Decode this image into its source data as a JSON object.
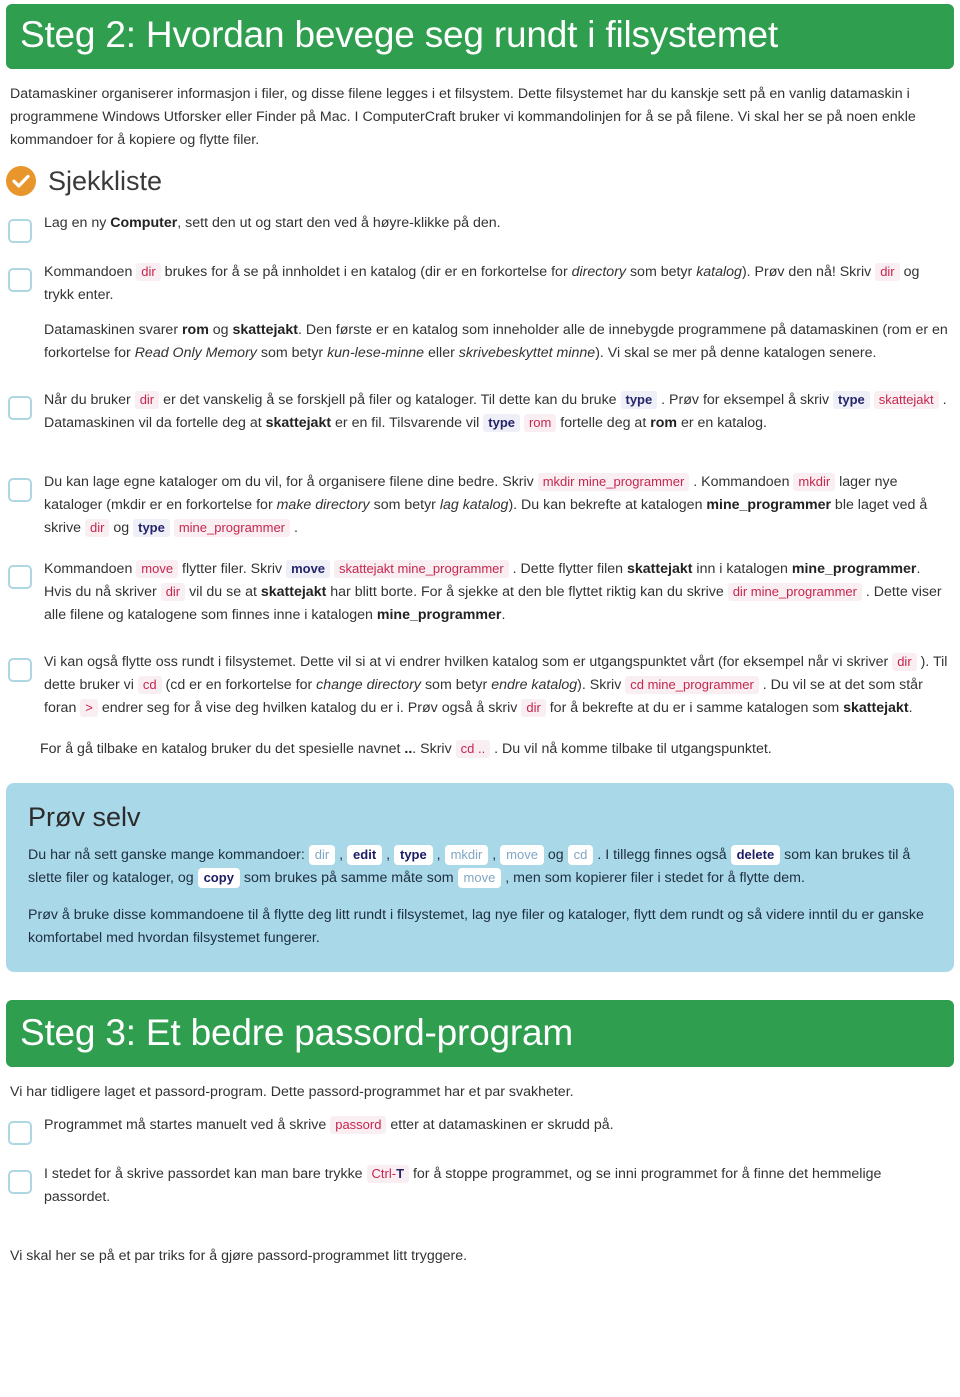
{
  "step2": {
    "header": "Steg 2: Hvordan bevege seg rundt i filsystemet",
    "intro": "Datamaskiner organiserer informasjon i filer, og disse filene legges i et filsystem. Dette filsystemet har du kanskje sett på en vanlig datamaskin i programmene Windows Utforsker eller Finder på Mac. I ComputerCraft bruker vi kommandolinjen for å se på filene. Vi skal her se på noen enkle kommandoer for å kopiere og flytte filer.",
    "checklist_icon": "check-circle-icon",
    "checklist_title": "Sjekkliste",
    "items": [
      {
        "id": "item-lag-computer",
        "html": "Lag en ny <b>Computer</b>, sett den ut og start den ved å høyre-klikke på den."
      },
      {
        "id": "item-dir",
        "html": "<p>Kommandoen <code class=\"c c-pink\">dir</code> brukes for å se på innholdet i en katalog (dir er en forkortelse for <i>directory</i> som betyr <i>katalog</i>). Prøv den nå! Skriv <code class=\"c c-pink\">dir</code> og trykk enter.</p><p>Datamaskinen svarer <b>rom</b> og <b>skattejakt</b>. Den første er en katalog som inneholder alle de innebygde programmene på datamaskinen (rom er en forkortelse for <i>Read Only Memory</i> som betyr <i>kun-lese-minne</i> eller <i>skrivebeskyttet minne</i>). Vi skal se mer på denne katalogen senere.</p>"
      },
      {
        "id": "item-type",
        "html": "Når du bruker <code class=\"c c-pink\">dir</code> er det vanskelig å se forskjell på filer og kataloger. Til dette kan du bruke <code class=\"c c-navy\">type</code> . Prøv for eksempel å skriv <code class=\"c c-navy\">type</code> <code class=\"c c-pink\">skattejakt</code> . Datamaskinen vil da fortelle deg at <b>skattejakt</b> er en fil. Tilsvarende vil <code class=\"c c-navy\">type</code> <code class=\"c c-pink\">rom</code> fortelle deg at <b>rom</b> er en katalog."
      },
      {
        "id": "item-mkdir",
        "html": "Du kan lage egne kataloger om du vil, for å organisere filene dine bedre. Skriv <code class=\"c c-pink\">mkdir mine_programmer</code> . Kommandoen <code class=\"c c-pink\">mkdir</code> lager nye kataloger (mkdir er en forkortelse for <i>make directory</i> som betyr <i>lag katalog</i>). Du kan bekrefte at katalogen <b>mine_programmer</b> ble laget ved å skrive <code class=\"c c-pink\">dir</code> og <code class=\"c c-navy\">type</code> <code class=\"c c-pink\">mine_programmer</code> ."
      },
      {
        "id": "item-move",
        "html": "Kommandoen <code class=\"c c-pink\">move</code> flytter filer. Skriv <code class=\"c c-navy\">move</code> <code class=\"c c-pink\">skattejakt mine_programmer</code> . Dette flytter filen <b>skattejakt</b> inn i katalogen <b>mine_programmer</b>. Hvis du nå skriver <code class=\"c c-pink\">dir</code> vil du se at <b>skattejakt</b> har blitt borte. For å sjekke at den ble flyttet riktig kan du skrive <code class=\"c c-pink\">dir mine_programmer</code> . Dette viser alle filene og katalogene som finnes inne i katalogen <b>mine_programmer</b>."
      },
      {
        "id": "item-cd",
        "html": "Vi kan også flytte oss rundt i filsystemet. Dette vil si at vi endrer hvilken katalog som er utgangspunktet vårt (for eksempel når vi skriver <code class=\"c c-pink\">dir</code> ). Til dette bruker vi <code class=\"c c-pink\">cd</code> (cd er en forkortelse for <i>change directory</i> som betyr <i>endre katalog</i>). Skriv <code class=\"c c-pink\">cd mine_programmer</code> . Du vil se at det som står foran <code class=\"c c-pink\">&gt;</code> endrer seg for å vise deg hvilken katalog du er i. Prøv også å skriv <code class=\"c c-pink\">dir</code> for å bekrefte at du er i samme katalogen som <b>skattejakt</b>."
      }
    ],
    "trailing_paragraph": "For å gå tilbake en katalog bruker du det spesielle navnet <b>..</b>. Skriv <code class=\"c c-pink\">cd ..</code> . Du vil nå komme tilbake til utgangspunktet."
  },
  "try_box": {
    "title": "Prøv selv",
    "paragraph1": "Du har nå sett ganske mange kommandoer: <span class=\"chip light\">dir</span> , <span class=\"chip bold\">edit</span> , <span class=\"chip bold\">type</span> , <span class=\"chip light\">mkdir</span> , <span class=\"chip light\">move</span> og <span class=\"chip light\">cd</span> . I tillegg finnes også <span class=\"chip bold\">delete</span> som kan brukes til å slette filer og kataloger, og <span class=\"chip bold\">copy</span> som brukes på samme måte som <span class=\"chip light\">move</span> , men som kopierer filer i stedet for å flytte dem.",
    "paragraph2": "Prøv å bruke disse kommandoene til å flytte deg litt rundt i filsystemet, lag nye filer og kataloger, flytt dem rundt og så videre inntil du er ganske komfortabel med hvordan filsystemet fungerer.",
    "commands": [
      "dir",
      "edit",
      "type",
      "mkdir",
      "move",
      "cd",
      "delete",
      "copy"
    ]
  },
  "step3": {
    "header": "Steg 3: Et bedre passord-program",
    "intro": "Vi har tidligere laget et passord-program. Dette passord-programmet har et par svakheter.",
    "items": [
      {
        "id": "item-passord-manuelt",
        "html": "Programmet må startes manuelt ved å skrive <code class=\"c c-pink\">passord</code> etter at datamaskinen er skrudd på."
      },
      {
        "id": "item-ctrl-t",
        "html": "I stedet for å skrive passordet kan man bare trykke <code class=\"c c-pink\">Ctrl-<b style=\"color:#26256b\">T</b></code> for å stoppe programmet, og se inni programmet for å finne det hemmelige passordet."
      }
    ],
    "closing": "Vi skal her se på et par triks for å gjøre passord-programmet litt tryggere."
  },
  "colors": {
    "header_green": "#2f9e4f",
    "checkbox_blue": "#aed7e4",
    "check_orange": "#e8952b",
    "code_pink": "#c7254e",
    "code_navy": "#26256b",
    "try_box_bg": "#a9d9e9"
  }
}
